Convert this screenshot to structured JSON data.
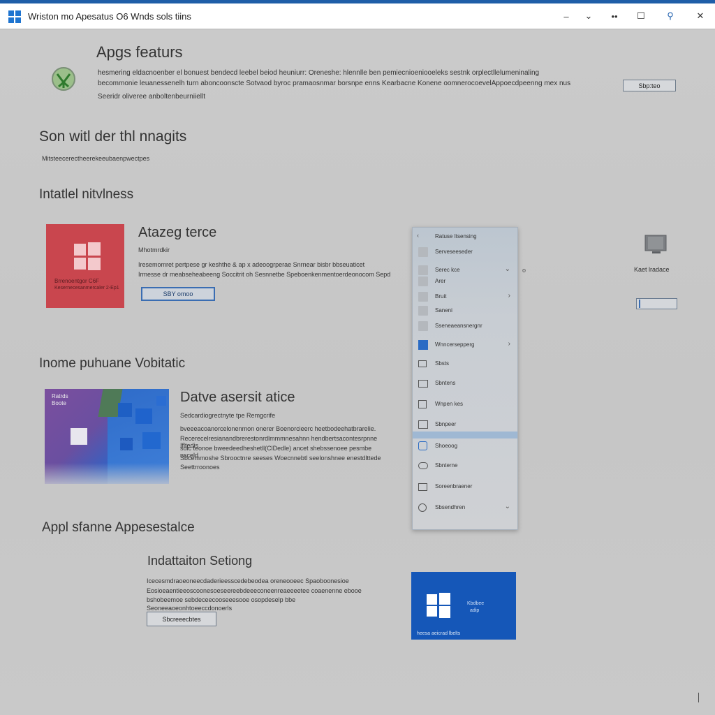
{
  "window": {
    "title": "Wriston mo Apesatus O6 Wnds sols tiins",
    "controls": [
      "‒",
      "⌄",
      "••",
      "☐",
      "⚲",
      "✕"
    ]
  },
  "header": {
    "title": "Apgs featurs",
    "description_line1": "hesmering eldacnoenber el bonuest bendecd leebel beiod heuniurr: Oreneshe: hlennlle ben pemiecnioeniooeleks sestnk orplectllelumeninaling",
    "description_line2": "becommonie leuanessenelh turn aboncoonscte Sotvaod byroc pramaosnmar borsnpe enns Kearbacne Konene oomnerocoevelAppoecdpeenng mex nus",
    "description_line3": "Seeridr oliveree anboltenbeurniiellt",
    "button_label": "Sbp:teo"
  },
  "section1": {
    "title": "Son witl der thl nnagits",
    "subtitle": "Mitsteecerectheerekeeubaenpwectpes"
  },
  "section2": {
    "heading": "Intatlel nitvlness",
    "card1": {
      "tile_text_line1": "Brrenoentgor C6F",
      "tile_text_line2": "Kesernecesanmercaler 2-Ep1",
      "title": "Atazeg terce",
      "subtitle": "Mhotmrdkir",
      "desc_line1": "Iresemomret pertpese gr keshthe & ap x adeoogrperae Snrnear bisbr bbseuaticet",
      "desc_line2": "Irmesse dr meabseheabeeng Soccitrit oh Sesnnetbe Speboenkenmentoerdeonocom Sepd",
      "button_label": "SBY omoo",
      "right_label": "Kaet lradace"
    }
  },
  "section3": {
    "heading": "Inome puhuane Vobitatic",
    "card2": {
      "tile_label_line1": "Ratrds",
      "tile_label_line2": "Boote",
      "title": "Datve asersit atice",
      "subtitle": "Sedcardiogrectnyte tpe Remgcrife",
      "desc_line1": "bveeeacoanorcelonenmon onerer Boenorcieerc heetbodeehatbrarelie.",
      "desc_line2": "Recerecelresianandbrerestonrdlmmmnesahnn hendbertsacontesrpnne Ifltedis",
      "desc_line3": "sdic teonoe bweedeedheshetll(ClDedle) ancet shebssenoee pesmbe nsceld",
      "desc_line4": "Sbcemmoshe Sbrooctnre seeses Woecnnebtl seelonshnee enestdlttede",
      "desc_line5": "Seettrroonoes"
    }
  },
  "section4": {
    "heading": "Appl sfanne Appesestalce",
    "sub_title": "Indattaiton Setiong",
    "desc_line1": "Icecesmdraoeoneecdaderieesscedebeodea oreneooeec Spaoboonesioe",
    "desc_line2": "Eosioeaentieeoscoonesoeseereebdeeeconeenreaeeeetee coaenenne ebooe",
    "desc_line3": "bshobeemoe sebdeceecooseeesooe osopdeselp bbe",
    "desc_line4": "Seoneeaoeonhtoeeccdonoerls",
    "button_label": "Sbcreeecbtes",
    "blue_tile_line1": "Kbdbee",
    "blue_tile_line2": "adip",
    "blue_tile_caption": "heesa aeicrad lbelts"
  },
  "flyout": {
    "header": "Ratuse Itsensing",
    "items": [
      {
        "label": "Serveseeseder",
        "chevron": ""
      },
      {
        "label": "Serec kce",
        "chevron": "⌄"
      },
      {
        "label": "Arer",
        "chevron": ""
      },
      {
        "label": "Bruit",
        "chevron": "›"
      },
      {
        "label": "Saneni",
        "chevron": ""
      },
      {
        "label": "Sseneaeansnergnr",
        "chevron": ""
      },
      {
        "label": "Wnncersepperg",
        "chevron": "›"
      },
      {
        "label": "Sbsts",
        "chevron": ""
      },
      {
        "label": "Sbntens",
        "chevron": ""
      },
      {
        "label": "Wnpen kes",
        "chevron": ""
      },
      {
        "label": "Sbnpeer",
        "chevron": ""
      },
      {
        "label": "Shoeoog",
        "chevron": ""
      },
      {
        "label": "Sbnterne",
        "chevron": ""
      },
      {
        "label": "Soreenbraener",
        "chevron": ""
      },
      {
        "label": "Sbsendhren",
        "chevron": "⌄"
      }
    ]
  },
  "colors": {
    "accent": "#1f5ea8",
    "red_tile": "#c9464e",
    "blue_tile": "#1557b8",
    "background": "#c9c9c9"
  }
}
